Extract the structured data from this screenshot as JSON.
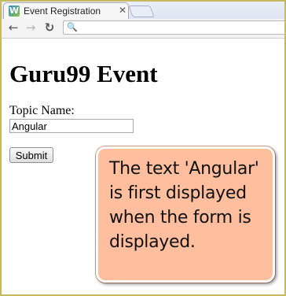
{
  "browser": {
    "tab": {
      "favicon_glyph": "W",
      "title": "Event Registration",
      "close_glyph": "✕"
    },
    "toolbar": {
      "back_glyph": "←",
      "forward_glyph": "→",
      "reload_glyph": "↻",
      "search_icon_glyph": "🔍",
      "address_value": ""
    }
  },
  "page": {
    "title": "Guru99 Event",
    "topic_label": "Topic Name:",
    "topic_value": "Angular",
    "submit_label": "Submit"
  },
  "annotation": {
    "text": "The text 'Angular' is first displayed when the form is displayed."
  },
  "colors": {
    "callout_background": "#ffbf9e",
    "frame_border": "#c9b95e"
  }
}
